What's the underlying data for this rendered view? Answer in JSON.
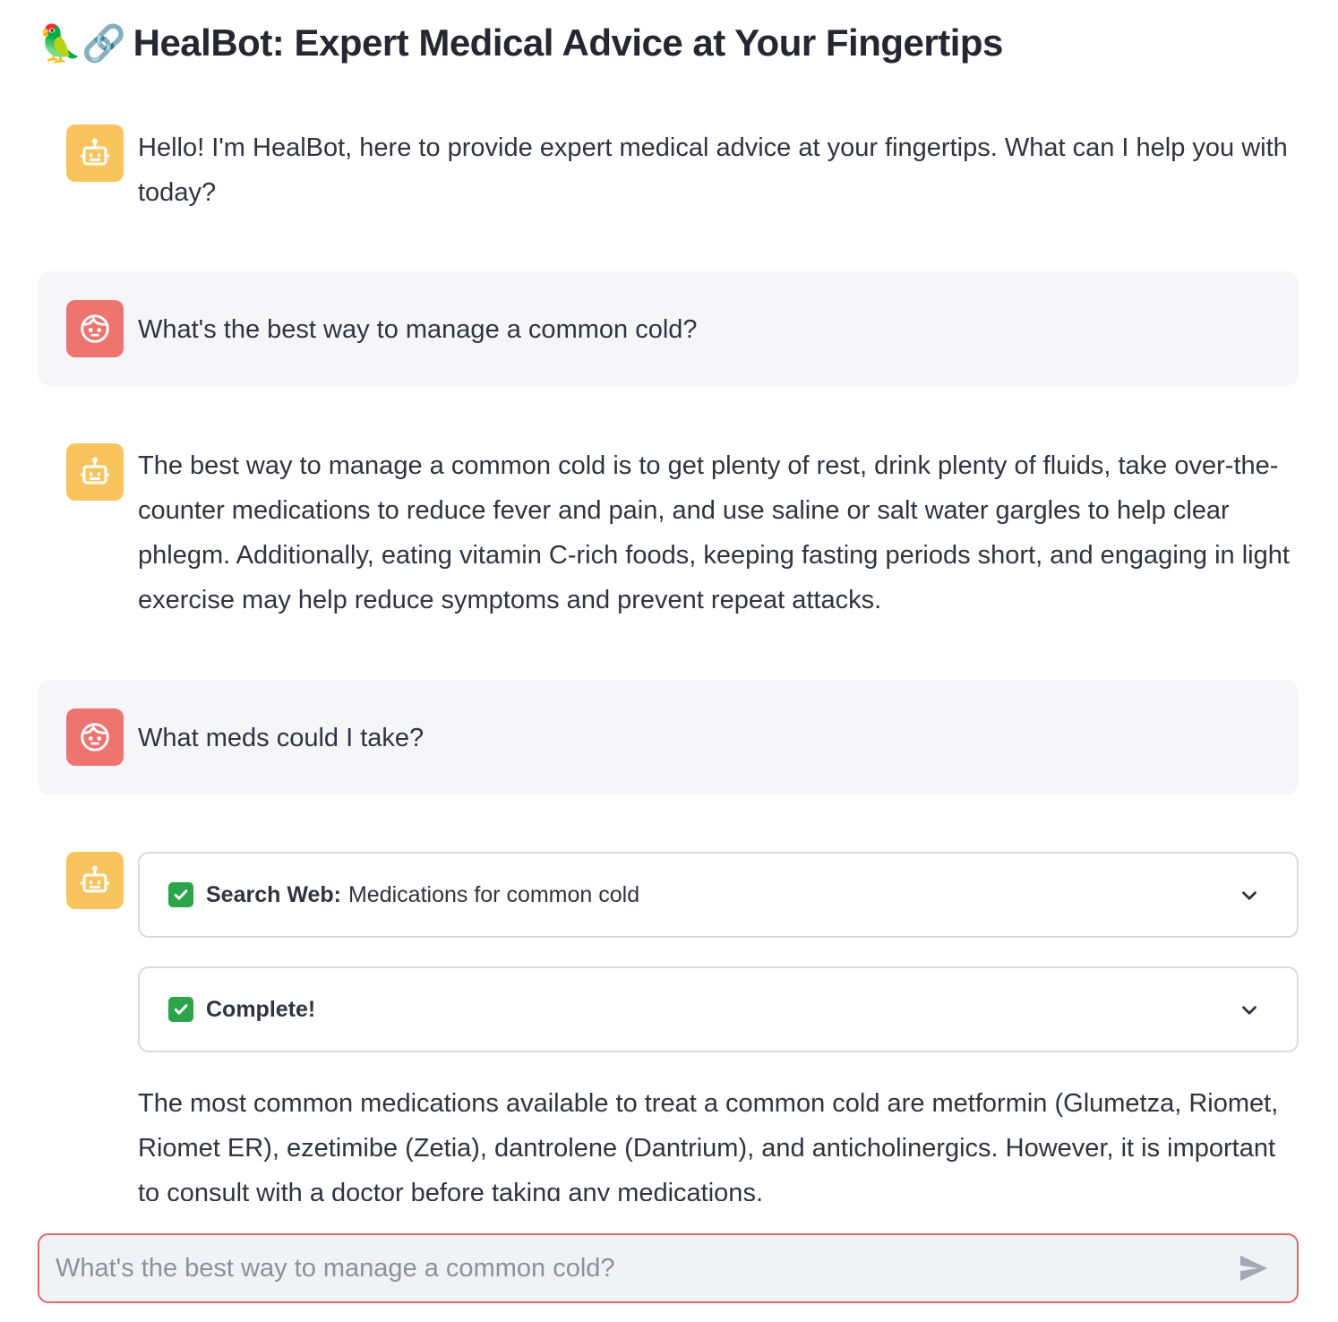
{
  "app": {
    "title_emoji": "🦜🔗",
    "title": "HealBot: Expert Medical Advice at Your Fingertips"
  },
  "messages": [
    {
      "role": "assistant",
      "avatar_icon": "robot-icon",
      "text": "Hello! I'm HealBot, here to provide expert medical advice at your fingertips. What can I help you with today?"
    },
    {
      "role": "user",
      "avatar_icon": "user-face-icon",
      "text": "What's the best way to manage a common cold?"
    },
    {
      "role": "assistant",
      "avatar_icon": "robot-icon",
      "text": "The best way to manage a common cold is to get plenty of rest, drink plenty of fluids, take over-the-counter medications to reduce fever and pain, and use saline or salt water gargles to help clear phlegm. Additionally, eating vitamin C-rich foods, keeping fasting periods short, and engaging in light exercise may help reduce symptoms and prevent repeat attacks."
    },
    {
      "role": "user",
      "avatar_icon": "user-face-icon",
      "text": "What meds could I take?"
    },
    {
      "role": "assistant",
      "avatar_icon": "robot-icon",
      "steps": [
        {
          "status_icon": "check-icon",
          "label": "Search Web:",
          "detail": "Medications for common cold"
        },
        {
          "status_icon": "check-icon",
          "label": "Complete!",
          "detail": ""
        }
      ],
      "text": "The most common medications available to treat a common cold are metformin (Glumetza, Riomet, Riomet ER), ezetimibe (Zetia), dantrolene (Dantrium), and anticholinergics. However, it is important to consult with a doctor before taking any medications."
    }
  ],
  "chat_input": {
    "placeholder": "What's the best way to manage a common cold?",
    "value": "",
    "send_icon": "send-icon"
  },
  "colors": {
    "assistant_avatar": "#f9c45e",
    "user_avatar": "#ee7470",
    "user_bubble": "#f6f6f9",
    "input_border": "#e06863",
    "check": "#2ca44a"
  }
}
